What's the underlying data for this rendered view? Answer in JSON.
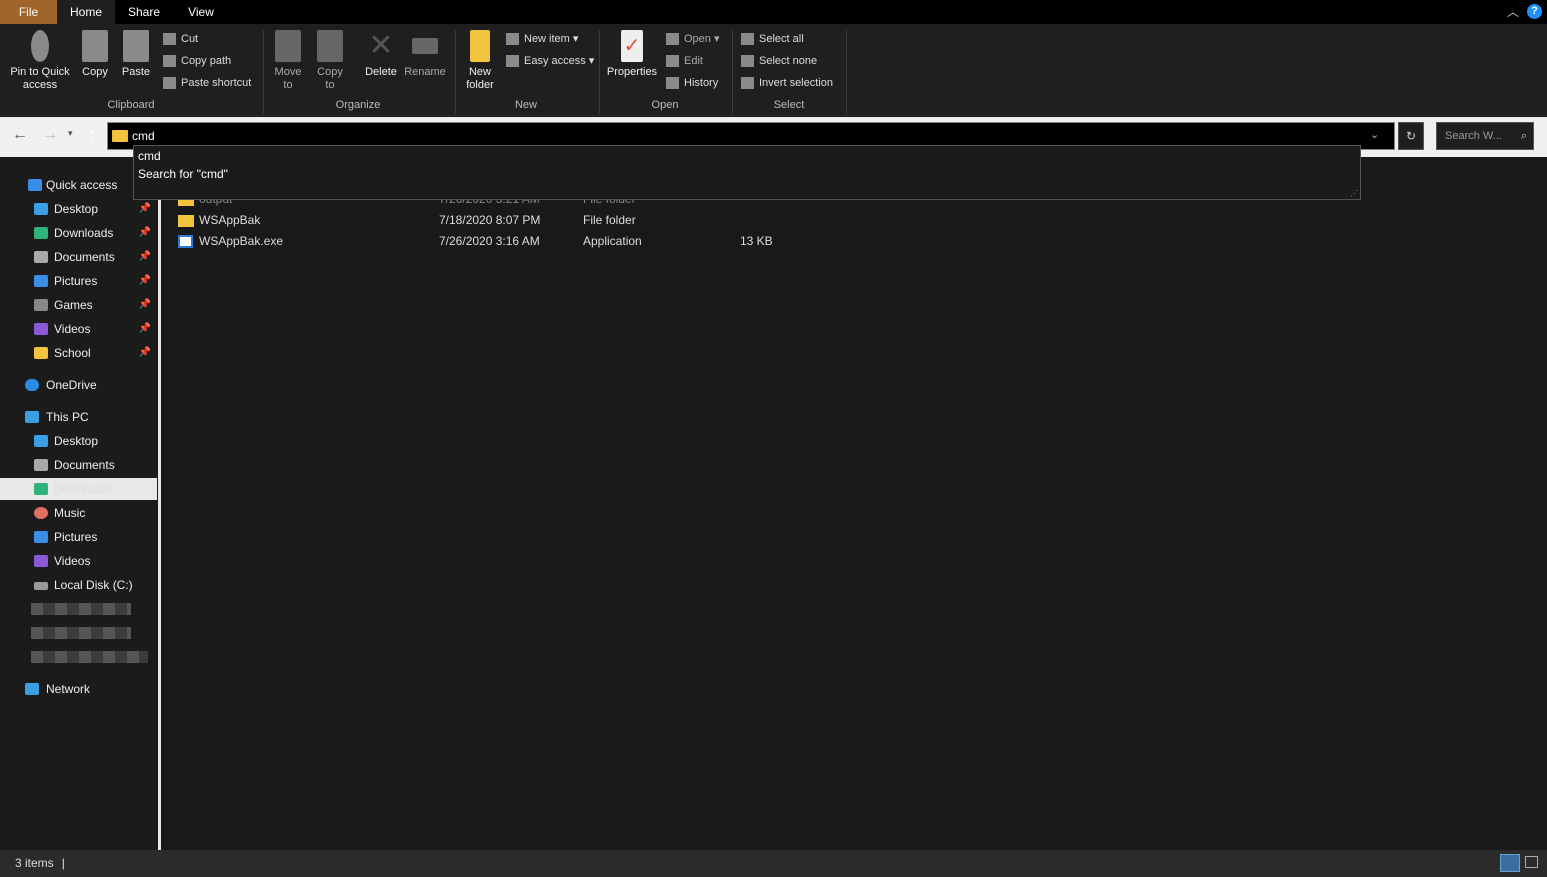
{
  "tabs": [
    "File",
    "Home",
    "Share",
    "View"
  ],
  "ribbon": {
    "clipboard": {
      "pin": "Pin to Quick access",
      "copy": "Copy",
      "paste": "Paste",
      "cut": "Cut",
      "copy_path": "Copy path",
      "paste_shortcut": "Paste shortcut",
      "label": "Clipboard"
    },
    "organize": {
      "move_to": "Move to",
      "copy_to": "Copy to",
      "delete": "Delete",
      "rename": "Rename",
      "label": "Organize"
    },
    "new": {
      "new_folder": "New folder",
      "new_item": "New item",
      "easy_access": "Easy access",
      "label": "New"
    },
    "open": {
      "properties": "Properties",
      "open": "Open",
      "edit": "Edit",
      "history": "History",
      "label": "Open"
    },
    "select": {
      "select_all": "Select all",
      "select_none": "Select none",
      "invert": "Invert selection",
      "label": "Select"
    }
  },
  "address": {
    "value": "cmd",
    "search_placeholder": "Search W..."
  },
  "suggestions": [
    "cmd",
    "Search for \"cmd\""
  ],
  "sidebar": {
    "quick_access": "Quick access",
    "quick_items": [
      "Desktop",
      "Downloads",
      "Documents",
      "Pictures",
      "Games",
      "Videos",
      "School"
    ],
    "onedrive": "OneDrive",
    "this_pc": "This PC",
    "pc_items": [
      "Desktop",
      "Documents",
      "Downloads",
      "Music",
      "Pictures",
      "Videos",
      "Local Disk (C:)"
    ],
    "network": "Network"
  },
  "files": [
    {
      "name": "output",
      "date": "7/26/2020 3:21 AM",
      "type": "File folder",
      "size": ""
    },
    {
      "name": "WSAppBak",
      "date": "7/18/2020 8:07 PM",
      "type": "File folder",
      "size": ""
    },
    {
      "name": "WSAppBak.exe",
      "date": "7/26/2020 3:16 AM",
      "type": "Application",
      "size": "13 KB"
    }
  ],
  "status": {
    "count": "3 items"
  },
  "colors": {
    "file_tab": "#a0652a",
    "folder": "#f2c33c",
    "accent": "#1e90ff"
  }
}
